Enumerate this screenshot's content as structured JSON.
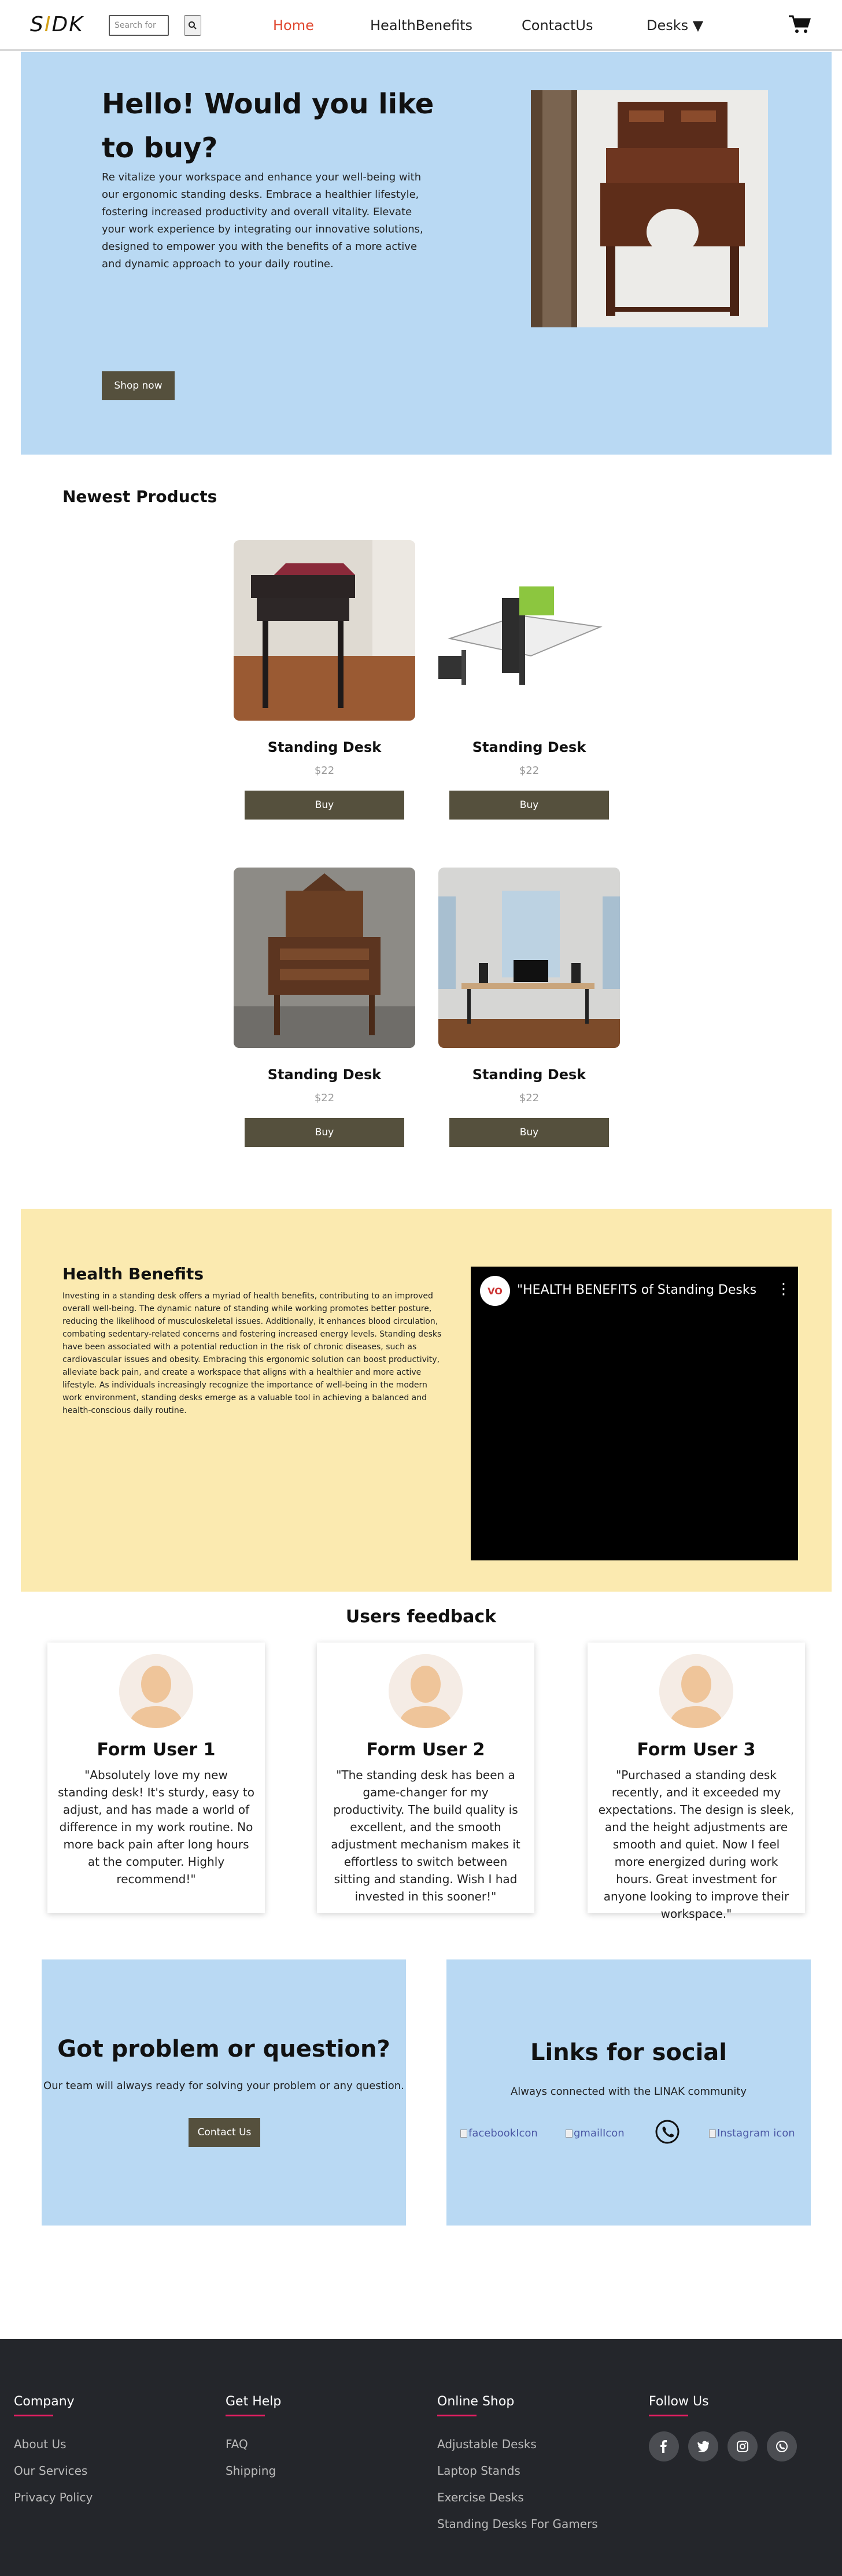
{
  "header": {
    "logo": {
      "s": "S",
      "i": "I",
      "dk": "DK"
    },
    "search_placeholder": "Search for",
    "nav": [
      "Home",
      "HealthBenefits",
      "ContactUs",
      "Desks ▼"
    ]
  },
  "hero": {
    "title": "Hello! Would you like to buy?",
    "text": "Re vitalize your workspace and enhance your well-being with our ergonomic standing desks. Embrace a healthier lifestyle, fostering increased productivity and overall vitality. Elevate your work experience by integrating our innovative solutions, designed to empower you with the benefits of a more active and dynamic approach to your daily routine.",
    "button": "Shop now"
  },
  "newest": {
    "title": "Newest Products",
    "products": [
      {
        "name": "Standing Desk",
        "price": "$22",
        "buy": "Buy"
      },
      {
        "name": "Standing Desk",
        "price": "$22",
        "buy": "Buy"
      },
      {
        "name": "Standing Desk",
        "price": "$22",
        "buy": "Buy"
      },
      {
        "name": "Standing Desk",
        "price": "$22",
        "buy": "Buy"
      }
    ]
  },
  "health": {
    "title": "Health Benefits",
    "text": "Investing in a standing desk offers a myriad of health benefits, contributing to an improved overall well-being. The dynamic nature of standing while working promotes better posture, reducing the likelihood of musculoskeletal issues. Additionally, it enhances blood circulation, combating sedentary-related concerns and fostering increased energy levels. Standing desks have been associated with a potential reduction in the risk of chronic diseases, such as cardiovascular issues and obesity. Embracing this ergonomic solution can boost productivity, alleviate back pain, and create a workspace that aligns with a healthier and more active lifestyle. As individuals increasingly recognize the importance of well-being in the modern work environment, standing desks emerge as a valuable tool in achieving a balanced and health-conscious daily routine.",
    "video_title": "\"HEALTH BENEFITS of Standing Desks ...",
    "video_logo": "VO"
  },
  "feedback": {
    "title": "Users feedback",
    "users": [
      {
        "name": "Form User 1",
        "text": "\"Absolutely love my new standing desk! It's sturdy, easy to adjust, and has made a world of difference in my work routine. No more back pain after long hours at the computer. Highly recommend!\""
      },
      {
        "name": "Form User 2",
        "text": "\"The standing desk has been a game-changer for my productivity. The build quality is excellent, and the smooth adjustment mechanism makes it effortless to switch between sitting and standing. Wish I had invested in this sooner!\""
      },
      {
        "name": "Form User 3",
        "text": "\"Purchased a standing desk recently, and it exceeded my expectations. The design is sleek, and the height adjustments are smooth and quiet. Now I feel more energized during work hours. Great investment for anyone looking to improve their workspace.\""
      }
    ]
  },
  "contact": {
    "title": "Got problem or question?",
    "text": "Our team will always ready for solving your problem or any question.",
    "button": "Contact Us"
  },
  "social": {
    "title": "Links for social",
    "text": "Always connected with the LINAK community",
    "links": [
      "facebookIcon",
      "gmailIcon",
      "Instagram icon"
    ]
  },
  "footer": {
    "columns": [
      {
        "title": "Company",
        "items": [
          "About Us",
          "Our Services",
          "Privacy Policy"
        ]
      },
      {
        "title": "Get Help",
        "items": [
          "FAQ",
          "Shipping"
        ]
      },
      {
        "title": "Online Shop",
        "items": [
          "Adjustable Desks",
          "Laptop Stands",
          "Exercise Desks",
          "Standing Desks For Gamers"
        ]
      },
      {
        "title": "Follow Us",
        "items": []
      }
    ]
  },
  "icons": {
    "search": "search-icon",
    "cart": "cart-icon",
    "whatsapp": "whatsapp-icon",
    "footer_social": [
      "facebook-icon",
      "twitter-icon",
      "instagram-icon",
      "whatsapp-icon"
    ]
  },
  "colors": {
    "hero_bg": "#b9d9f3",
    "health_bg": "#fbeab0",
    "button": "#55503d",
    "nav_active": "#e0472f",
    "footer_bg": "#24262b",
    "footer_accent": "#e91e63"
  }
}
